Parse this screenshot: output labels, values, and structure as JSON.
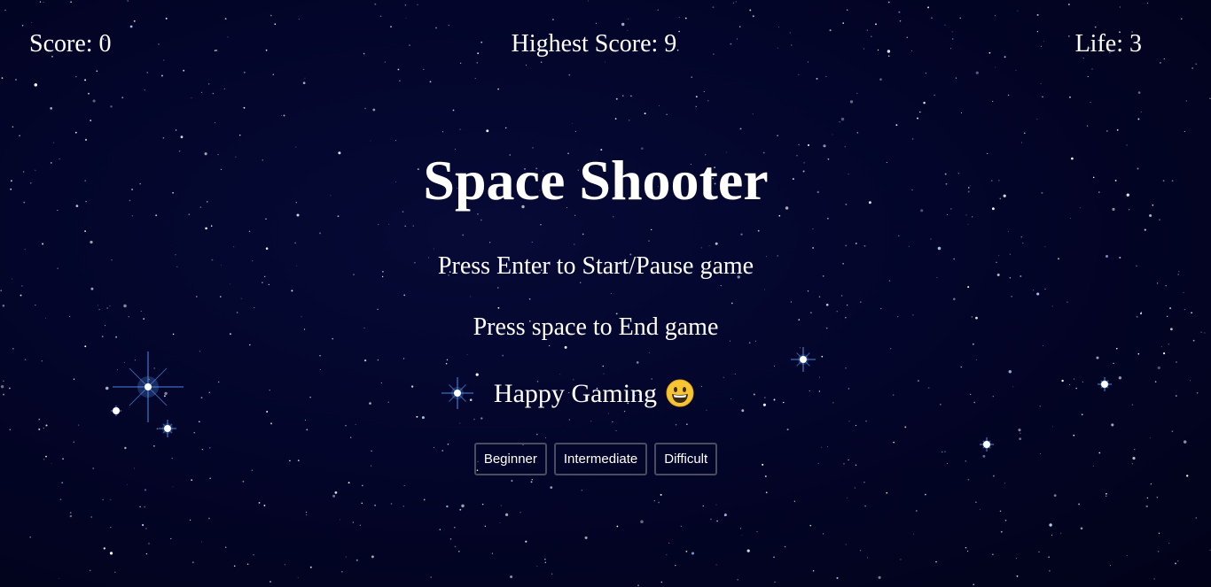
{
  "hud": {
    "score": "Score: 0",
    "highest": "Highest Score: 9",
    "life": "Life: 3"
  },
  "title": "Space Shooter",
  "instructions": {
    "start_pause": "Press Enter to Start/Pause game",
    "end": "Press space to End game",
    "greeting": "Happy Gaming"
  },
  "levels": [
    "Beginner",
    "Intermediate",
    "Difficult"
  ],
  "colors": {
    "background": "#03052a",
    "text": "#ffffff",
    "button_border": "#4a4d5e",
    "smiley_face": "#f7c531"
  },
  "icons": {
    "greeting_emoji": "grinning-face-icon"
  }
}
